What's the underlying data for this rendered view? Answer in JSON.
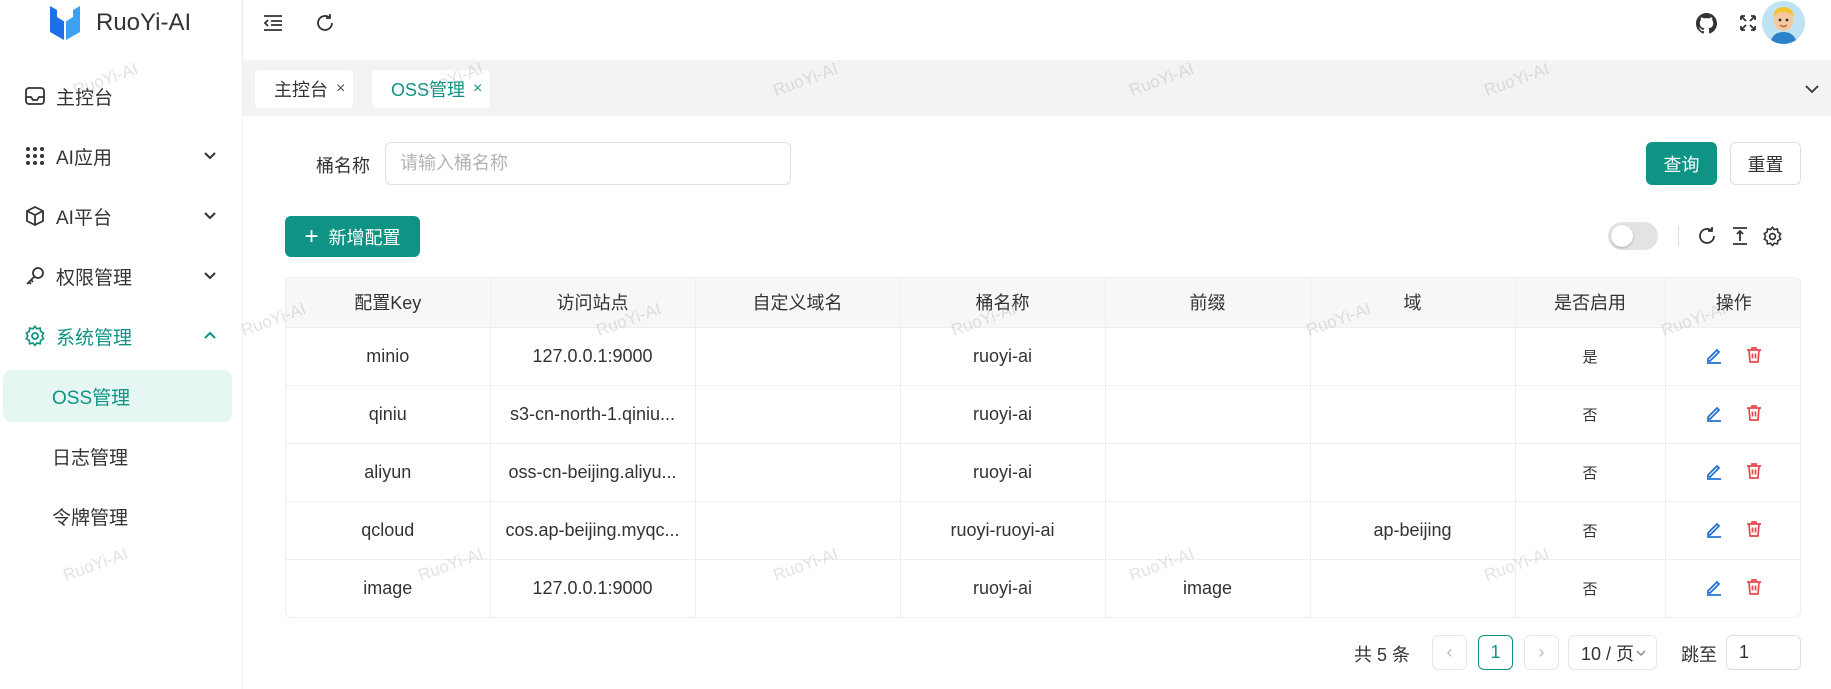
{
  "app": {
    "name": "RuoYi-AI"
  },
  "sidebar": {
    "items": [
      {
        "label": "主控台",
        "icon": "dashboard-icon"
      },
      {
        "label": "AI应用",
        "icon": "apps-grid-icon"
      },
      {
        "label": "AI平台",
        "icon": "cube-icon"
      },
      {
        "label": "权限管理",
        "icon": "key-icon"
      },
      {
        "label": "系统管理",
        "icon": "settings-gear-icon",
        "expanded": true
      }
    ],
    "submenu": [
      {
        "label": "OSS管理",
        "active": true
      },
      {
        "label": "日志管理"
      },
      {
        "label": "令牌管理"
      }
    ]
  },
  "header": {
    "icons": [
      "collapse-menu-icon",
      "refresh-icon",
      "github-icon",
      "fullscreen-icon",
      "user-avatar"
    ]
  },
  "tabs": [
    {
      "label": "主控台",
      "close": "×"
    },
    {
      "label": "OSS管理",
      "close": "×",
      "active": true
    }
  ],
  "filter": {
    "label": "桶名称",
    "placeholder": "请输入桶名称",
    "value": "",
    "query_label": "查询",
    "reset_label": "重置"
  },
  "toolbar": {
    "add_label": "新增配置",
    "add_icon": "+",
    "toggle_on": false
  },
  "table": {
    "columns": [
      "配置Key",
      "访问站点",
      "自定义域名",
      "桶名称",
      "前缀",
      "域",
      "是否启用",
      "操作"
    ],
    "rows": [
      [
        "minio",
        "127.0.0.1:9000",
        "",
        "ruoyi-ai",
        "",
        "",
        "是"
      ],
      [
        "qiniu",
        "s3-cn-north-1.qiniu...",
        "",
        "ruoyi-ai",
        "",
        "",
        "否"
      ],
      [
        "aliyun",
        "oss-cn-beijing.aliyu...",
        "",
        "ruoyi-ai",
        "",
        "",
        "否"
      ],
      [
        "qcloud",
        "cos.ap-beijing.myqc...",
        "",
        "ruoyi-ruoyi-ai",
        "",
        "ap-beijing",
        "否"
      ],
      [
        "image",
        "127.0.0.1:9000",
        "",
        "ruoyi-ai",
        "image",
        "",
        "否"
      ]
    ]
  },
  "pagination": {
    "total_text": "共 5 条",
    "prev": "‹",
    "current_page": "1",
    "next": "›",
    "page_size": "10 / 页",
    "jump_label": "跳至",
    "jump_value": "1"
  },
  "watermark": "RuoYi-AI",
  "colors": {
    "primary": "#0e9384",
    "danger": "#e5484d",
    "edit": "#1f6fd1"
  }
}
